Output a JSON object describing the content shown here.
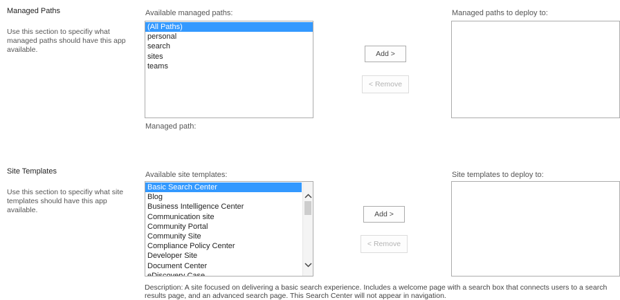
{
  "managed_paths": {
    "title": "Managed Paths",
    "description": "Use this section to specifiy what managed paths should have this app available.",
    "available_label": "Available managed paths:",
    "available_items": [
      "(All Paths)",
      "personal",
      "search",
      "sites",
      "teams"
    ],
    "selected_index": 0,
    "add_label": "Add >",
    "remove_label": "< Remove",
    "deploy_label": "Managed paths to deploy to:",
    "managed_path_label": "Managed path:"
  },
  "site_templates": {
    "title": "Site Templates",
    "description": "Use this section to specifiy what site templates should have this app available.",
    "available_label": "Available site templates:",
    "available_items": [
      "Basic Search Center",
      "Blog",
      "Business Intelligence Center",
      "Communication site",
      "Community Portal",
      "Community Site",
      "Compliance Policy Center",
      "Developer Site",
      "Document Center",
      "eDiscovery Case"
    ],
    "selected_index": 0,
    "add_label": "Add >",
    "remove_label": "< Remove",
    "deploy_label": "Site templates to deploy to:",
    "description_text": "Description:   A site focused on delivering a basic search experience. Includes a welcome page with a search box that connects users to a search results page, and an advanced search page. This Search Center will not appear in navigation."
  },
  "icons": {
    "scroll_up": "chevron-up-icon",
    "scroll_down": "chevron-down-icon"
  }
}
